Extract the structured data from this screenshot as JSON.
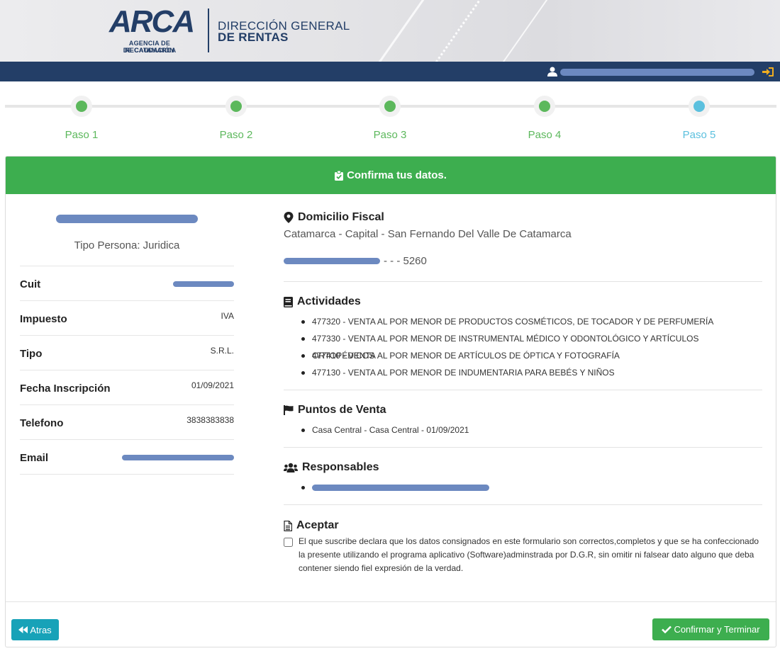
{
  "header": {
    "logo_word": "ARCA",
    "logo_sub1": "AGENCIA DE RECAUDACIÓN",
    "logo_sub2": "DE CATAMARCA",
    "org_line1": "DIRECCIÓN GENERAL",
    "org_line2": "DE RENTAS"
  },
  "navbar": {
    "user_icon": "user-icon",
    "logout_icon": "sign-in-icon"
  },
  "steps": [
    {
      "label": "Paso 1",
      "state": "done"
    },
    {
      "label": "Paso 2",
      "state": "done"
    },
    {
      "label": "Paso 3",
      "state": "done"
    },
    {
      "label": "Paso 4",
      "state": "done"
    },
    {
      "label": "Paso 5",
      "state": "current"
    }
  ],
  "card": {
    "title": "Confirma tus datos.",
    "title_icon": "clipboard-check-icon"
  },
  "profile": {
    "tipo_persona": "Tipo Persona: Juridica",
    "rows": [
      {
        "label": "Cuit",
        "value": ""
      },
      {
        "label": "Impuesto",
        "value": "IVA"
      },
      {
        "label": "Tipo",
        "value": "S.R.L."
      },
      {
        "label": "Fecha Inscripción",
        "value": "01/09/2021"
      },
      {
        "label": "Telefono",
        "value": "3838383838"
      },
      {
        "label": "Email",
        "value": ""
      }
    ]
  },
  "domicilio": {
    "title": "Domicilio Fiscal",
    "line1": "Catamarca - Capital - San Fernando Del Valle De Catamarca",
    "line2_suffix": "- - - 5260"
  },
  "actividades": {
    "title": "Actividades",
    "items": [
      "477320 - VENTA AL POR MENOR DE PRODUCTOS COSMÉTICOS, DE TOCADOR Y DE PERFUMERÍA",
      "477330 - VENTA AL POR MENOR DE INSTRUMENTAL MÉDICO Y ODONTOLÓGICO Y ARTÍCULOS ORTOPÉDICOS",
      "477410 - VENTA AL POR MENOR DE ARTÍCULOS DE ÓPTICA Y FOTOGRAFÍA",
      "477130 - VENTA AL POR MENOR DE INDUMENTARIA PARA BEBÉS Y NIÑOS"
    ]
  },
  "puntos_venta": {
    "title": "Puntos de Venta",
    "items": [
      "Casa Central - Casa Central - 01/09/2021"
    ]
  },
  "responsables": {
    "title": "Responsables"
  },
  "aceptar": {
    "title": "Aceptar",
    "text": "El que suscribe declara que los datos consignados en este formulario son correctos,completos y que se ha confeccionado la presente utilizando el programa aplicativo (Software)adminstrada por D.G.R, sin omitir ni falsear dato alguno que deba contener siendo fiel expresión de la verdad.",
    "checked": false
  },
  "buttons": {
    "back": "Atras",
    "confirm": "Confirmar y Terminar"
  },
  "colors": {
    "brand": "#233e67",
    "success": "#3dae4f",
    "info": "#17a2b8",
    "step_current": "#5bc0de"
  }
}
